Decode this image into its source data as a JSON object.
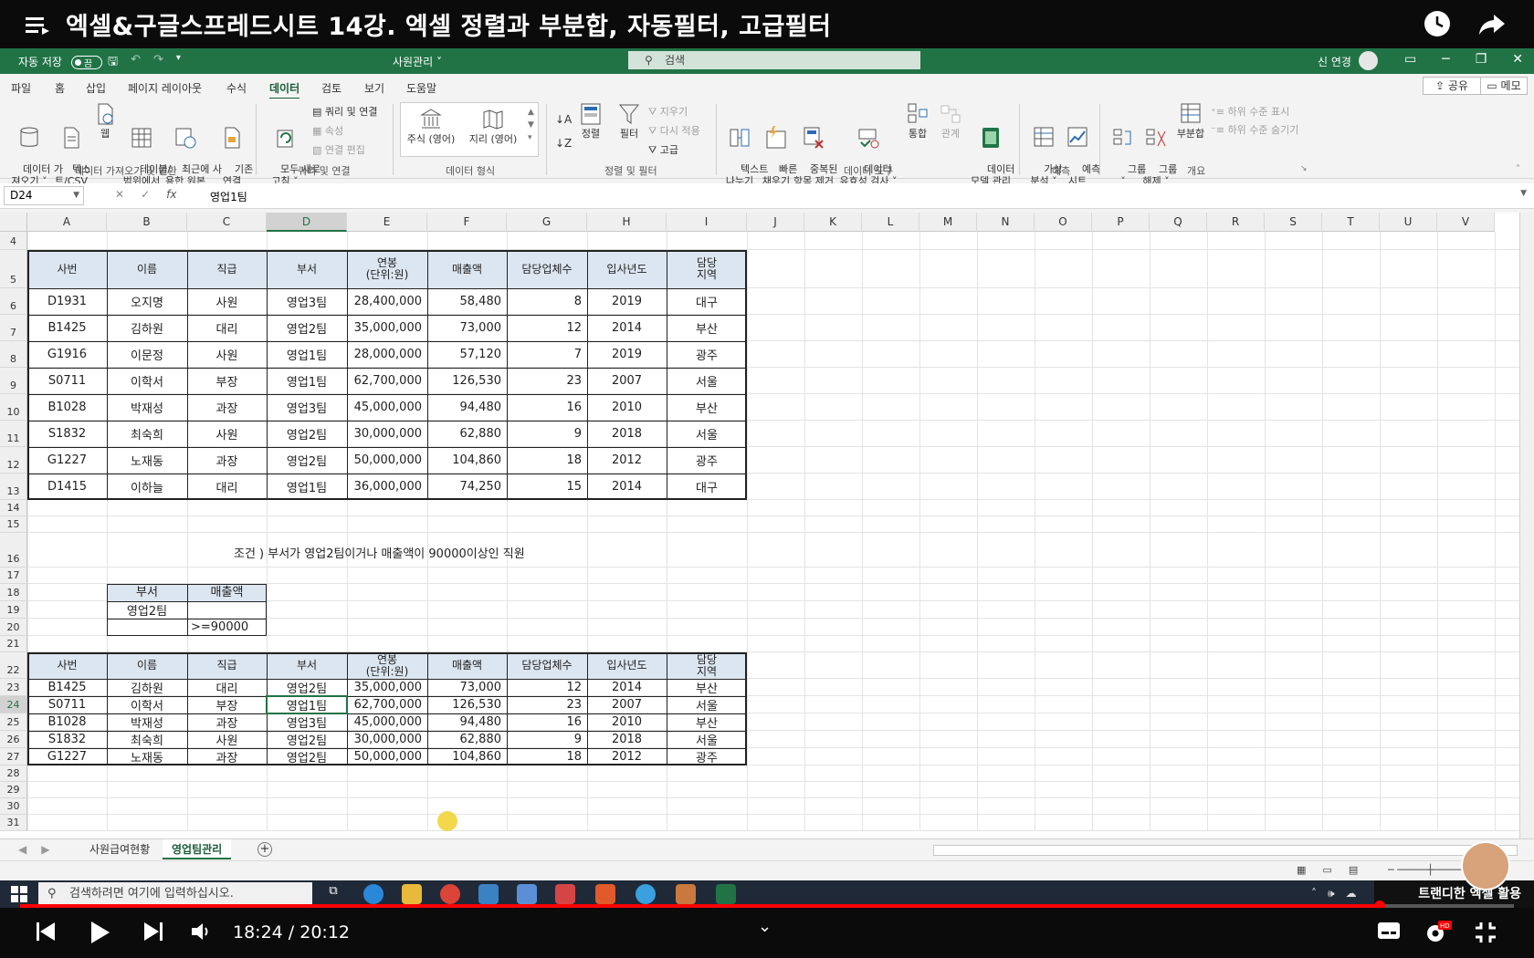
{
  "youtube": {
    "video_title": "엑셀&구글스프레드시트 14강. 엑셀 정렬과 부분합, 자동필터, 고급필터",
    "time_current": "18:24",
    "time_total": "20:12",
    "progress": 0.91,
    "channel": "트랜디한 엑셀 활용"
  },
  "excel": {
    "autosave_label": "자동 저장",
    "autosave_state": "끔",
    "doc_name": "사원관리 ˅",
    "search_placeholder": "검색",
    "user_name": "신 연경",
    "tabs": [
      "파일",
      "홈",
      "삽입",
      "페이지 레이아웃",
      "수식",
      "데이터",
      "검토",
      "보기",
      "도움말"
    ],
    "active_tab": "데이터",
    "share_label": "공유",
    "memo_label": "메모",
    "ribbon": {
      "get_data": "데이터 가\n져오기 ˅",
      "text_csv": "텍스\n트/CSV",
      "web": "웹",
      "from_table": "테이블/\n범위에서",
      "recent_sources": "최근에 사\n용한 원본",
      "existing_conn": "기존\n연결",
      "refresh_all": "모두 새로\n고침 ˅",
      "queries_conn": "쿼리 및 연결",
      "properties": "속성",
      "edit_links": "연결 편집",
      "stocks": "주식 (영어)",
      "geography": "지리 (영어)",
      "sort": "정렬",
      "filter": "필터",
      "clear": "지우기",
      "reapply": "다시 적용",
      "advanced": "고급",
      "text_to_cols": "텍스트\n나누기",
      "flash_fill": "빠른\n채우기",
      "remove_dup": "중복된\n항목 제거",
      "data_validation": "데이터\n유효성 검사 ˅",
      "consolidate": "통합",
      "relationships": "관계",
      "data_model": "데이터\n모델 관리",
      "whatif": "가상\n분석 ˅",
      "forecast_sheet": "예측\n시트",
      "group": "그룹\n˅",
      "ungroup": "그룹\n해제 ˅",
      "subtotal": "부분합",
      "show_detail": "하위 수준 표시",
      "hide_detail": "하위 수준 숨기기",
      "groups": {
        "get_transform": "데이터 가져오기 및 변환",
        "queries": "쿼리 및 연결",
        "data_types": "데이터 형식",
        "sort_filter": "정렬 및 필터",
        "data_tools": "데이터 도구",
        "forecast": "예측",
        "outline": "개요"
      }
    },
    "name_box": "D24",
    "formula_content": "영업1팀",
    "columns": [
      "A",
      "B",
      "C",
      "D",
      "E",
      "F",
      "G",
      "H",
      "I",
      "J",
      "K",
      "L",
      "M",
      "N",
      "O",
      "P",
      "Q",
      "R",
      "S",
      "T",
      "U",
      "V"
    ],
    "selected_column": "D",
    "selected_row": "24",
    "rows": [
      "4",
      "5",
      "6",
      "7",
      "8",
      "9",
      "10",
      "11",
      "12",
      "13",
      "14",
      "15",
      "16",
      "17",
      "18",
      "19",
      "20",
      "21",
      "22",
      "23",
      "24",
      "25",
      "26",
      "27",
      "28",
      "29",
      "30",
      "31"
    ],
    "table1": {
      "headers": [
        "사번",
        "이름",
        "직급",
        "부서",
        "연봉\n(단위:원)",
        "매출액",
        "담당업체수",
        "입사년도",
        "담당\n지역"
      ],
      "rows": [
        [
          "D1931",
          "오지명",
          "사원",
          "영업3팀",
          "28,400,000",
          "58,480",
          "8",
          "2019",
          "대구"
        ],
        [
          "B1425",
          "김하원",
          "대리",
          "영업2팀",
          "35,000,000",
          "73,000",
          "12",
          "2014",
          "부산"
        ],
        [
          "G1916",
          "이문정",
          "사원",
          "영업1팀",
          "28,000,000",
          "57,120",
          "7",
          "2019",
          "광주"
        ],
        [
          "S0711",
          "이학서",
          "부장",
          "영업1팀",
          "62,700,000",
          "126,530",
          "23",
          "2007",
          "서울"
        ],
        [
          "B1028",
          "박재성",
          "과장",
          "영업3팀",
          "45,000,000",
          "94,480",
          "16",
          "2010",
          "부산"
        ],
        [
          "S1832",
          "최숙희",
          "사원",
          "영업2팀",
          "30,000,000",
          "62,880",
          "9",
          "2018",
          "서울"
        ],
        [
          "G1227",
          "노재동",
          "과장",
          "영업2팀",
          "50,000,000",
          "104,860",
          "18",
          "2012",
          "광주"
        ],
        [
          "D1415",
          "이하늘",
          "대리",
          "영업1팀",
          "36,000,000",
          "74,250",
          "15",
          "2014",
          "대구"
        ]
      ]
    },
    "condition_note": "조건 ) 부서가 영업2팀이거나 매출액이 90000이상인 직원",
    "criteria": {
      "headers": [
        "부서",
        "매출액"
      ],
      "rows": [
        [
          "영업2팀",
          ""
        ],
        [
          "",
          ">=90000"
        ]
      ]
    },
    "table2": {
      "headers": [
        "사번",
        "이름",
        "직급",
        "부서",
        "연봉\n(단위:원)",
        "매출액",
        "담당업체수",
        "입사년도",
        "담당\n지역"
      ],
      "rows": [
        [
          "B1425",
          "김하원",
          "대리",
          "영업2팀",
          "35,000,000",
          "73,000",
          "12",
          "2014",
          "부산"
        ],
        [
          "S0711",
          "이학서",
          "부장",
          "영업1팀",
          "62,700,000",
          "126,530",
          "23",
          "2007",
          "서울"
        ],
        [
          "B1028",
          "박재성",
          "과장",
          "영업3팀",
          "45,000,000",
          "94,480",
          "16",
          "2010",
          "부산"
        ],
        [
          "S1832",
          "최숙희",
          "사원",
          "영업2팀",
          "30,000,000",
          "62,880",
          "9",
          "2018",
          "서울"
        ],
        [
          "G1227",
          "노재동",
          "과장",
          "영업2팀",
          "50,000,000",
          "104,860",
          "18",
          "2012",
          "광주"
        ]
      ]
    },
    "sheets": [
      "사원급여현황",
      "영업팀관리"
    ],
    "active_sheet": "영업팀관리"
  },
  "taskbar": {
    "search_placeholder": "검색하려면 여기에 입력하십시오."
  },
  "colors": {
    "excel_green": "#217346",
    "header_fill": "#dce6f1",
    "progress_red": "#ff0000"
  }
}
